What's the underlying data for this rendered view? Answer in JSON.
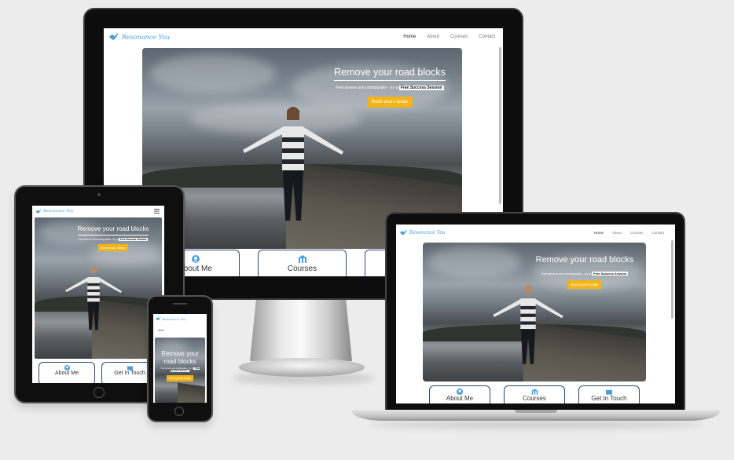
{
  "site": {
    "logo_text": "Resonance You",
    "nav": [
      "Home",
      "About",
      "Courses",
      "Contact"
    ],
    "hero_title": "Remove your road blocks",
    "hero_sub_prefix": "Feel serene and unstoppable - try a",
    "hero_sub_highlight": "Free Success Session",
    "cta": "Book yours today",
    "cards": [
      "About Me",
      "Courses",
      "Get In Touch"
    ]
  },
  "colors": {
    "accent": "#f2b418",
    "brand": "#4a9fd8",
    "card_border": "#2c4a6e",
    "background": "#ececec"
  },
  "icons": [
    "bird-logo-icon",
    "user-circle-icon",
    "building-icon",
    "envelope-icon",
    "hamburger-menu-icon"
  ]
}
